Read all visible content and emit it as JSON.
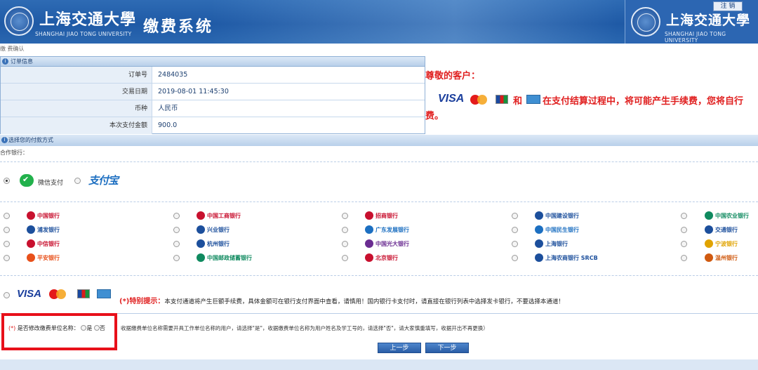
{
  "header": {
    "university_cn": "上海交通大學",
    "university_en": "SHANGHAI JIAO TONG UNIVERSITY",
    "system_title": "缴费系统",
    "logout_label": "注 销"
  },
  "breadcrumb": "缴 费确认",
  "order": {
    "section_title": "订单信息",
    "rows": [
      {
        "label": "订单号",
        "value": "2484035"
      },
      {
        "label": "交易日期",
        "value": "2019-08-01 11:45:30"
      },
      {
        "label": "币种",
        "value": "人民币"
      },
      {
        "label": "本次支付金额",
        "value": "900.0"
      }
    ]
  },
  "notice": {
    "title": "尊敬的客户：",
    "visa": "VISA",
    "and": "和",
    "line1": "在支付结算过程中，将可能产生手续费，您将自行",
    "line2": "费。"
  },
  "payment": {
    "section_title": "选择您的付款方式",
    "coop_label": "合作银行：",
    "wechat_label": "微信支付",
    "alipay_label": "支付宝"
  },
  "banks": [
    [
      "中国银行",
      "中国工商银行",
      "招商银行",
      "中国建设银行",
      "中国农业银行"
    ],
    [
      "浦发银行",
      "兴业银行",
      "广东发展银行",
      "中国民生银行",
      "交通银行"
    ],
    [
      "中信银行",
      "杭州银行",
      "中国光大银行",
      "上海银行",
      "宁波银行"
    ],
    [
      "平安银行",
      "中国邮政储蓄银行",
      "北京银行",
      "上海农商银行 SRCB",
      "温州银行"
    ]
  ],
  "bank_colors": [
    [
      "#c8102e",
      "#c8102e",
      "#c8102e",
      "#1c4f9c",
      "#0f8a5f"
    ],
    [
      "#1c4f9c",
      "#1c4f9c",
      "#1c6fc1",
      "#1c6fc1",
      "#1c4f9c"
    ],
    [
      "#c8102e",
      "#1c4f9c",
      "#6a2c91",
      "#1c4f9c",
      "#e0a300"
    ],
    [
      "#e8501a",
      "#0f8a5f",
      "#c8102e",
      "#1c4f9c",
      "#d05a10"
    ]
  ],
  "cards": {
    "visa": "VISA",
    "special_label": "(*)特别提示：",
    "special_text": "本支付通道将产生巨额手续费，具体金额可在银行支付界面中查看，请慎用！国内银行卡支付时，请直接在银行列表中选择发卡银行，不要选择本通道！"
  },
  "unit_question": {
    "marker": "(*)",
    "label": "是否修改缴费单位名称：",
    "yes": "是",
    "no": "否",
    "hint": "收据缴费单位名称需要开具工作单位名称的用户，请选择\"是\"，收据缴费单位名称为用户姓名及学工号的，请选择\"否\"，请大家慎重填写，收据开出不再更换）"
  },
  "buttons": {
    "prev": "上一步",
    "next": "下一步"
  }
}
